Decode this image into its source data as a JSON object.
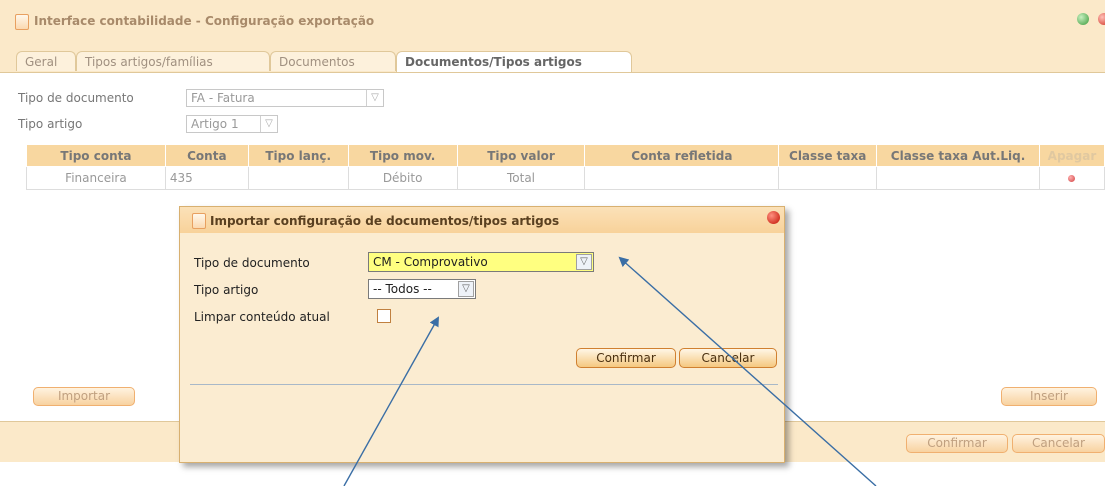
{
  "window": {
    "title": "Interface contabilidade - Configuração exportação"
  },
  "tabs": [
    {
      "label": "Geral"
    },
    {
      "label": "Tipos artigos/famílias"
    },
    {
      "label": "Documentos"
    },
    {
      "label": "Documentos/Tipos artigos",
      "active": true
    }
  ],
  "form": {
    "doc_type_label": "Tipo de documento",
    "doc_type_value": "FA - Fatura",
    "article_type_label": "Tipo artigo",
    "article_type_value": "Artigo 1"
  },
  "table": {
    "columns": [
      "Tipo conta",
      "Conta",
      "Tipo lanç.",
      "Tipo mov.",
      "Tipo valor",
      "Conta refletida",
      "Classe taxa",
      "Classe taxa Aut.Liq.",
      "Apagar"
    ],
    "rows": [
      {
        "tipo_conta": "Financeira",
        "conta": "435",
        "tipo_lanc": "",
        "tipo_mov": "Débito",
        "tipo_valor": "Total",
        "conta_refletida": "",
        "classe_taxa": "",
        "classe_taxa_aut": ""
      }
    ]
  },
  "buttons": {
    "importar": "Importar",
    "inserir": "Inserir",
    "confirmar": "Confirmar",
    "cancelar": "Cancelar"
  },
  "dialog": {
    "title": "Importar configuração de documentos/tipos artigos",
    "doc_type_label": "Tipo de documento",
    "doc_type_value": "CM - Comprovativo",
    "article_type_label": "Tipo artigo",
    "article_type_value": "-- Todos --",
    "clear_label": "Limpar conteúdo atual",
    "clear_checked": false,
    "confirm_label": "Confirmar",
    "cancel_label": "Cancelar"
  },
  "colors": {
    "accent": "#f8d7a0",
    "dialog_select_bg": "#ffff80",
    "arrow": "#3a6ea5"
  }
}
